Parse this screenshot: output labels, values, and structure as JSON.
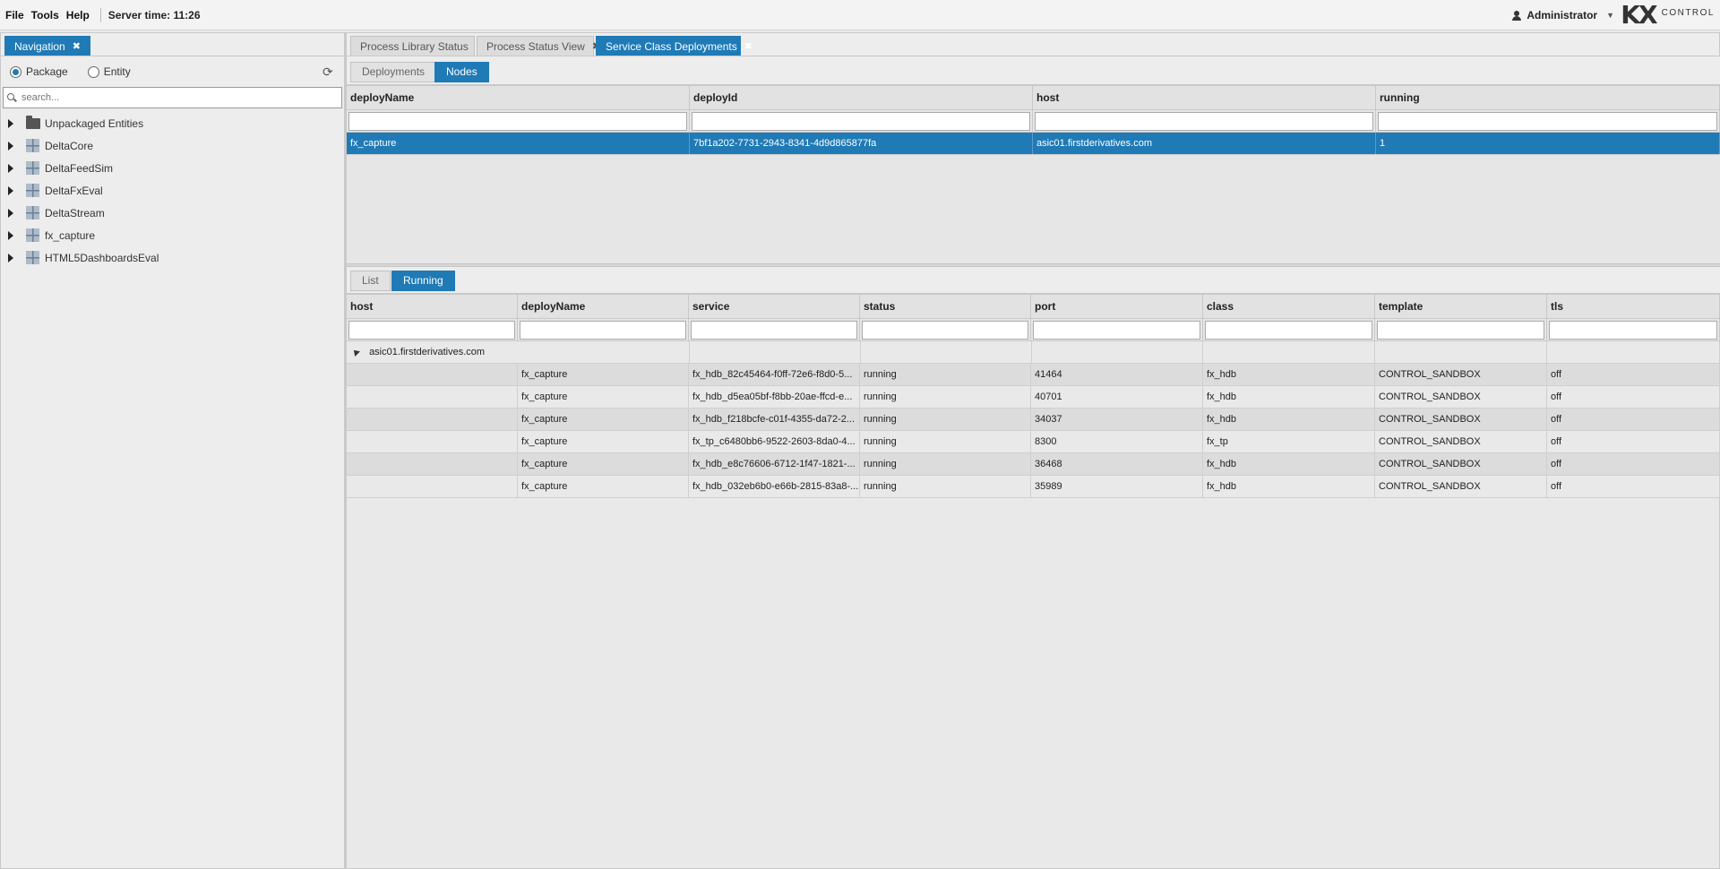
{
  "menu": {
    "file": "File",
    "tools": "Tools",
    "help": "Help",
    "server_time": "Server time: 11:26"
  },
  "user": {
    "name": "Administrator"
  },
  "logo": {
    "mark": "KX",
    "text": "CONTROL"
  },
  "navigation": {
    "tab_label": "Navigation",
    "radio_package": "Package",
    "radio_entity": "Entity",
    "selected_mode": "Package",
    "search_placeholder": "search...",
    "tree": [
      {
        "label": "Unpackaged Entities",
        "icon": "folder-icon"
      },
      {
        "label": "DeltaCore",
        "icon": "package-icon"
      },
      {
        "label": "DeltaFeedSim",
        "icon": "package-icon"
      },
      {
        "label": "DeltaFxEval",
        "icon": "package-icon"
      },
      {
        "label": "DeltaStream",
        "icon": "package-icon"
      },
      {
        "label": "fx_capture",
        "icon": "package-icon"
      },
      {
        "label": "HTML5DashboardsEval",
        "icon": "package-icon"
      }
    ]
  },
  "main_tabs": [
    {
      "label": "Process Library Status"
    },
    {
      "label": "Process Status View"
    },
    {
      "label": "Service Class Deployments",
      "active": true
    }
  ],
  "top_subtabs": {
    "deployments": "Deployments",
    "nodes": "Nodes",
    "active": "Nodes"
  },
  "nodes_grid": {
    "columns": [
      "deployName",
      "deployId",
      "host",
      "running"
    ],
    "rows": [
      {
        "deployName": "fx_capture",
        "deployId": "7bf1a202-7731-2943-8341-4d9d865877fa",
        "host": "asic01.firstderivatives.com",
        "running": "1"
      }
    ]
  },
  "bottom_subtabs": {
    "list": "List",
    "running": "Running",
    "active": "Running"
  },
  "running_grid": {
    "columns": [
      "host",
      "deployName",
      "service",
      "status",
      "port",
      "class",
      "template",
      "tls"
    ],
    "group": "asic01.firstderivatives.com",
    "rows": [
      {
        "deployName": "fx_capture",
        "service": "fx_hdb_82c45464-f0ff-72e6-f8d0-5...",
        "status": "running",
        "port": "41464",
        "class": "fx_hdb",
        "template": "CONTROL_SANDBOX",
        "tls": "off"
      },
      {
        "deployName": "fx_capture",
        "service": "fx_hdb_d5ea05bf-f8bb-20ae-ffcd-e...",
        "status": "running",
        "port": "40701",
        "class": "fx_hdb",
        "template": "CONTROL_SANDBOX",
        "tls": "off"
      },
      {
        "deployName": "fx_capture",
        "service": "fx_hdb_f218bcfe-c01f-4355-da72-2...",
        "status": "running",
        "port": "34037",
        "class": "fx_hdb",
        "template": "CONTROL_SANDBOX",
        "tls": "off"
      },
      {
        "deployName": "fx_capture",
        "service": "fx_tp_c6480bb6-9522-2603-8da0-4...",
        "status": "running",
        "port": "8300",
        "class": "fx_tp",
        "template": "CONTROL_SANDBOX",
        "tls": "off"
      },
      {
        "deployName": "fx_capture",
        "service": "fx_hdb_e8c76606-6712-1f47-1821-...",
        "status": "running",
        "port": "36468",
        "class": "fx_hdb",
        "template": "CONTROL_SANDBOX",
        "tls": "off"
      },
      {
        "deployName": "fx_capture",
        "service": "fx_hdb_032eb6b0-e66b-2815-83a8-...",
        "status": "running",
        "port": "35989",
        "class": "fx_hdb",
        "template": "CONTROL_SANDBOX",
        "tls": "off"
      }
    ]
  },
  "colors": {
    "accent": "#1f7ab6",
    "background": "#e9e9e9"
  }
}
